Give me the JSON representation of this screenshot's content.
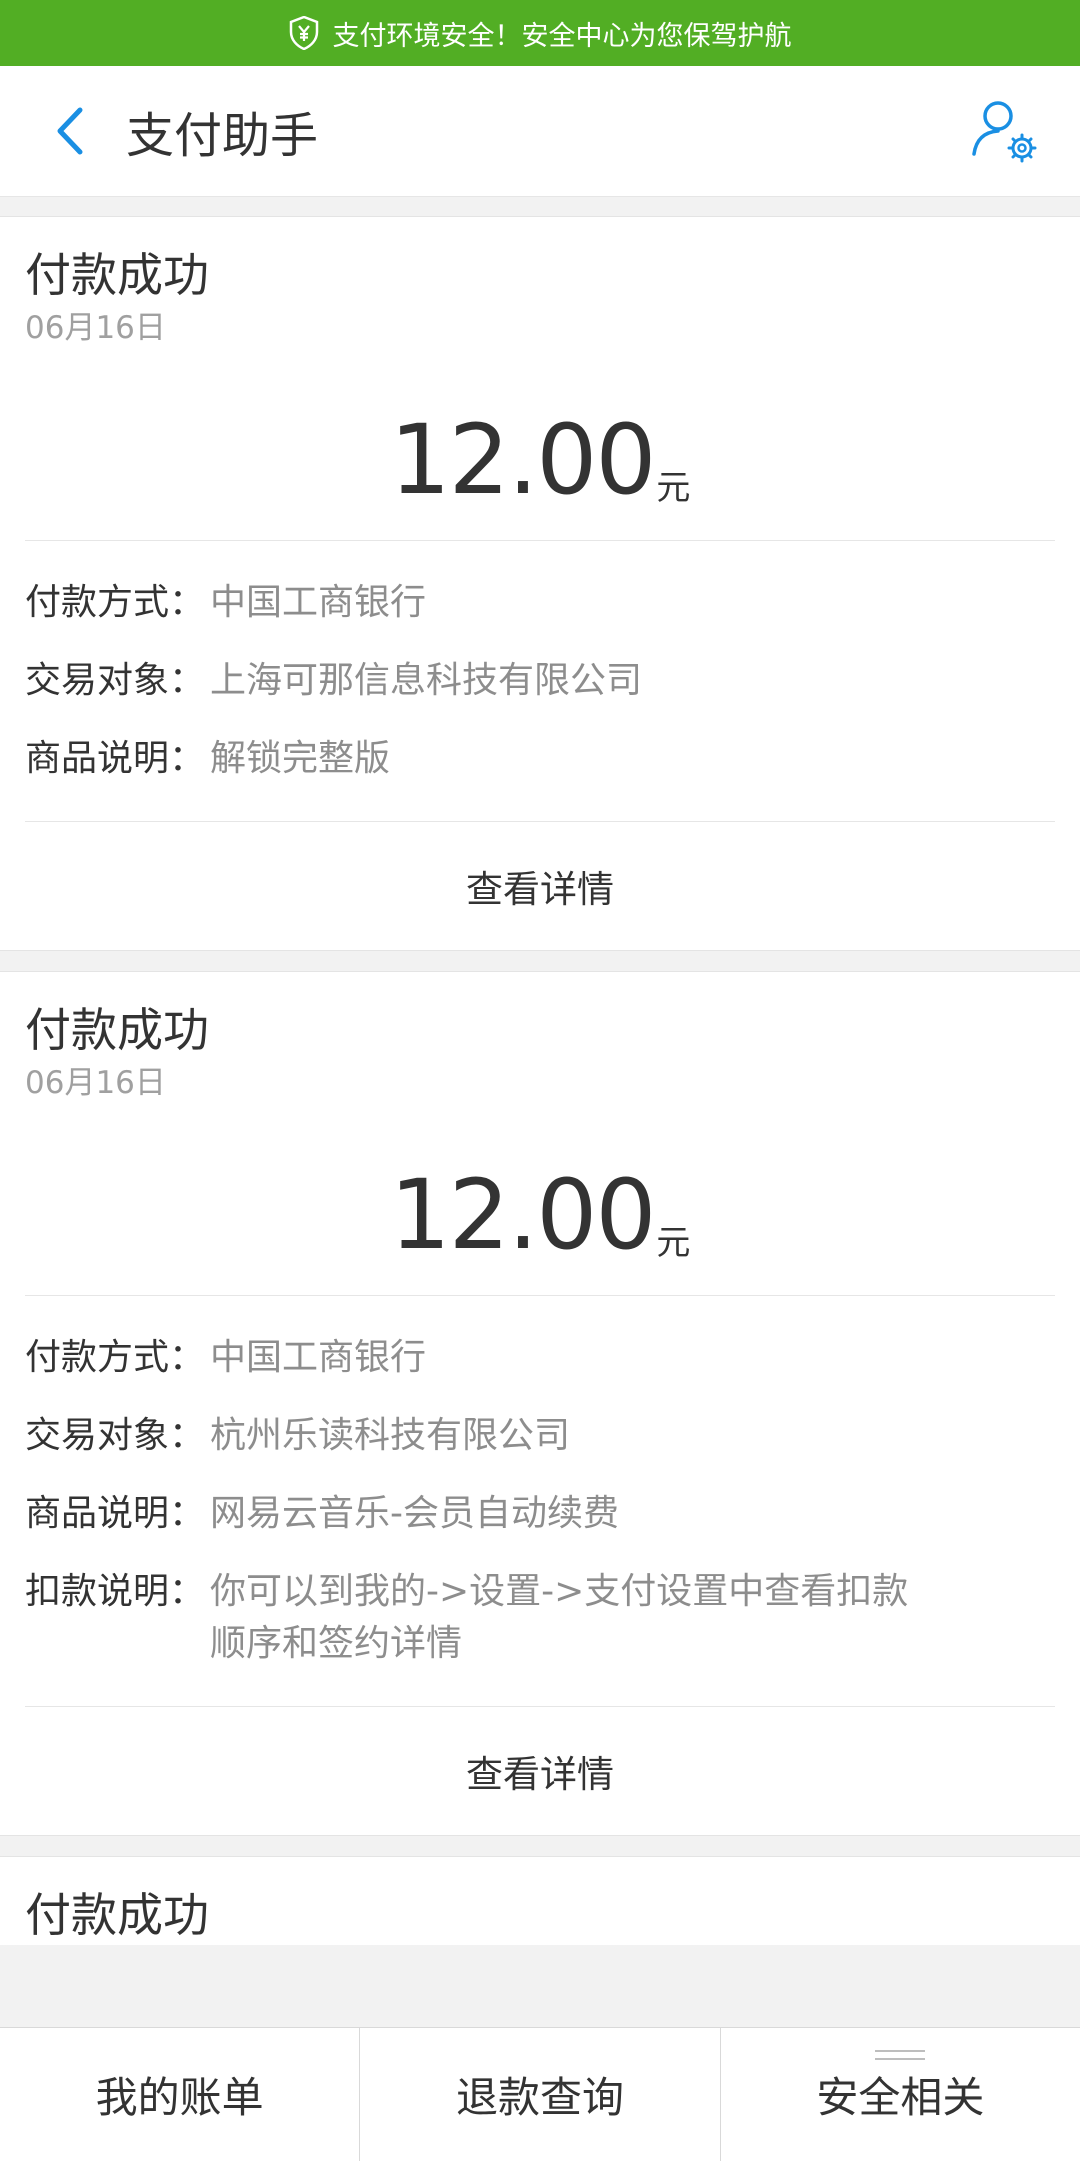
{
  "banner": {
    "text": "支付环境安全！安全中心为您保驾护航",
    "icon": "shield-yen-icon",
    "color": "#52ae24"
  },
  "header": {
    "title": "支付助手",
    "back_icon": "back-arrow-icon",
    "settings_icon": "user-settings-icon",
    "accent": "#1a8fe3"
  },
  "cards": [
    {
      "status": "付款成功",
      "date": "06月16日",
      "amount": "12.00",
      "unit": "元",
      "details": [
        {
          "label": "付款方式：",
          "value": "中国工商银行"
        },
        {
          "label": "交易对象：",
          "value": "上海可那信息科技有限公司"
        },
        {
          "label": "商品说明：",
          "value": "解锁完整版"
        }
      ],
      "action": "查看详情"
    },
    {
      "status": "付款成功",
      "date": "06月16日",
      "amount": "12.00",
      "unit": "元",
      "details": [
        {
          "label": "付款方式：",
          "value": "中国工商银行"
        },
        {
          "label": "交易对象：",
          "value": "杭州乐读科技有限公司"
        },
        {
          "label": "商品说明：",
          "value": "网易云音乐-会员自动续费"
        },
        {
          "label": "扣款说明：",
          "value": "你可以到我的->设置->支付设置中查看扣款顺序和签约详情"
        }
      ],
      "action": "查看详情"
    },
    {
      "status": "付款成功"
    }
  ],
  "bottom_tabs": [
    {
      "label": "我的账单"
    },
    {
      "label": "退款查询"
    },
    {
      "label": "安全相关",
      "icon": "menu-lines-icon"
    }
  ]
}
